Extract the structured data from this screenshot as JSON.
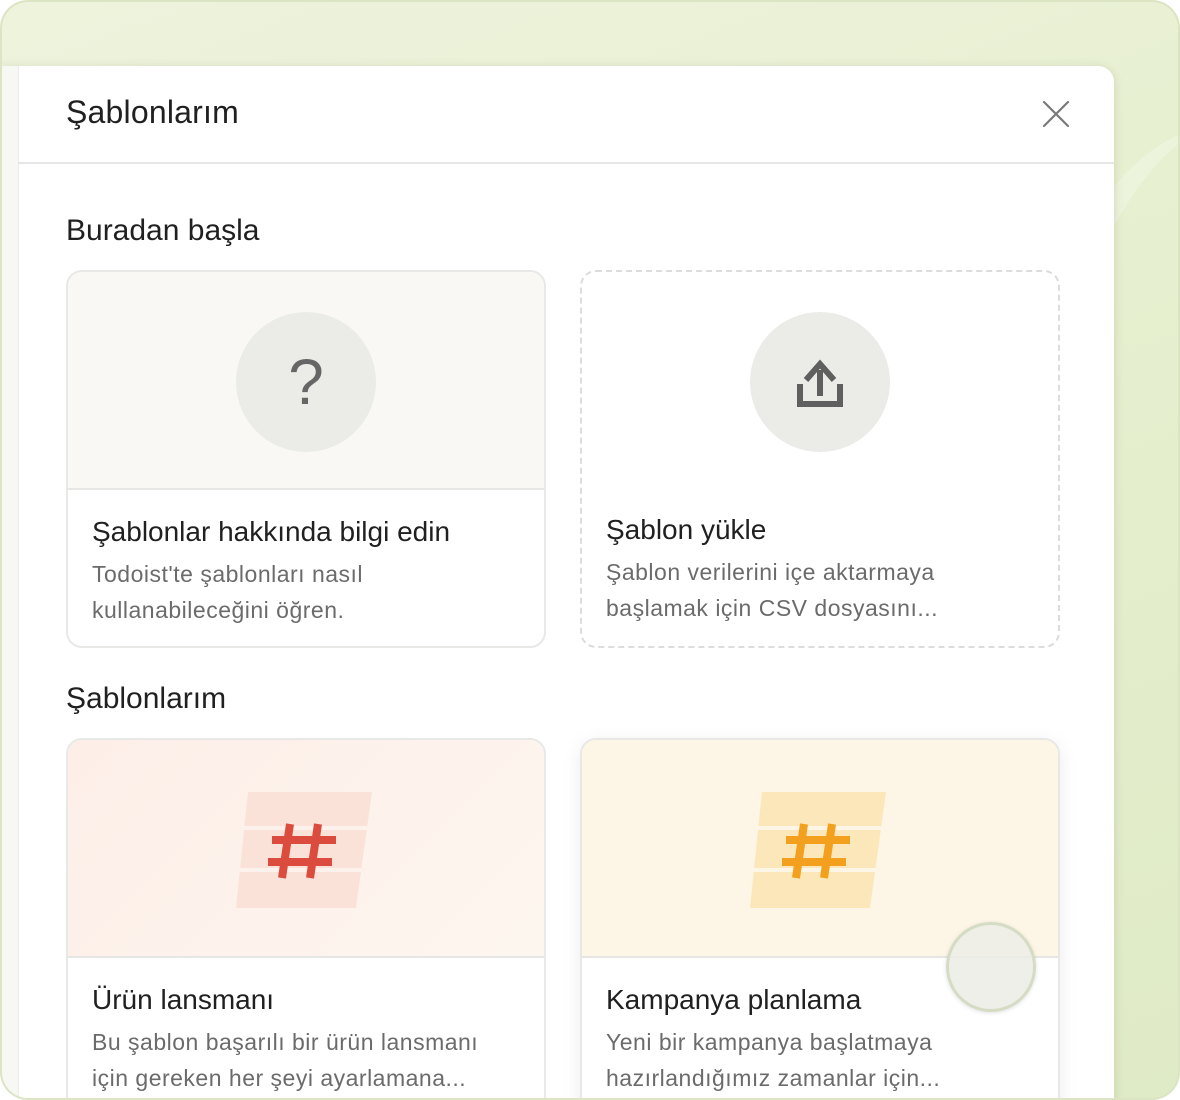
{
  "modal": {
    "title": "Şablonlarım",
    "close_icon": "close-icon"
  },
  "sections": {
    "start_here": "Buradan başla",
    "my_templates": "Şablonlarım"
  },
  "start_cards": [
    {
      "title": "Şablonlar hakkında bilgi edin",
      "description": "Todoist'te şablonları nasıl kullanabileceğini öğren.",
      "icon": "question-mark-icon",
      "icon_glyph": "?"
    },
    {
      "title": "Şablon yükle",
      "description": "Şablon verilerini içe aktarmaya başlamak için CSV dosyasını...",
      "icon": "upload-icon"
    }
  ],
  "template_cards": [
    {
      "title": "Ürün lansmanı",
      "description": "Bu şablon başarılı bir ürün lansmanı için gereken her şeyi ayarlamana...",
      "icon": "hashtag-icon",
      "accent": "#dc4c3e",
      "background": "#fdf1ec"
    },
    {
      "title": "Kampanya planlama",
      "description": "Yeni bir kampanya başlatmaya hazırlandığımız zamanlar için...",
      "icon": "hashtag-icon",
      "accent": "#f2a01e",
      "background": "#fdf6e6"
    }
  ],
  "colors": {
    "backdrop": "#e6efcf",
    "text_primary": "#202020",
    "text_secondary": "#6b6b6b"
  }
}
